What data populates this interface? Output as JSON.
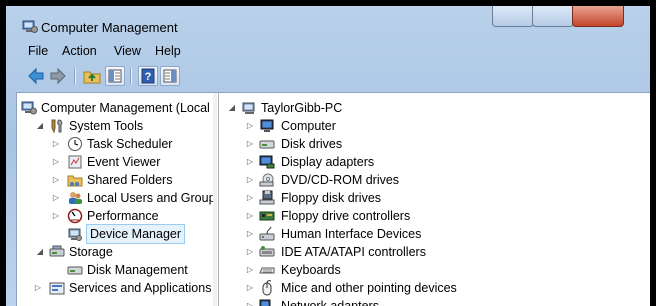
{
  "window": {
    "title": "Computer Management"
  },
  "menu": [
    "File",
    "Action",
    "View",
    "Help"
  ],
  "toolbar": {
    "buttons": [
      "back-icon",
      "forward-icon",
      "up-folder-icon",
      "show-hide-tree-icon",
      "help-icon",
      "show-hide-action-pane-icon"
    ]
  },
  "tree": {
    "root": "Computer Management (Local",
    "system_tools": "System Tools",
    "task_scheduler": "Task Scheduler",
    "event_viewer": "Event Viewer",
    "shared_folders": "Shared Folders",
    "local_users": "Local Users and Groups",
    "performance": "Performance",
    "device_manager": "Device Manager",
    "storage": "Storage",
    "disk_management": "Disk Management",
    "services_apps": "Services and Applications"
  },
  "devices": {
    "computer_name": "TaylorGibb-PC",
    "items": [
      "Computer",
      "Disk drives",
      "Display adapters",
      "DVD/CD-ROM drives",
      "Floppy disk drives",
      "Floppy drive controllers",
      "Human Interface Devices",
      "IDE ATA/ATAPI controllers",
      "Keyboards",
      "Mice and other pointing devices",
      "Network adapters"
    ]
  }
}
